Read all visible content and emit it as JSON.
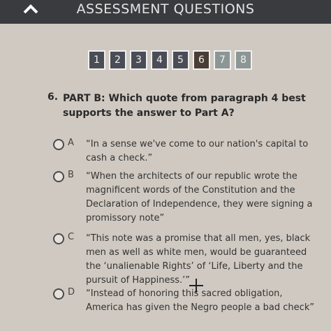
{
  "header": {
    "title": "ASSESSMENT QUESTIONS",
    "collapse_icon": "chevron-up-icon"
  },
  "nav": {
    "tabs": [
      {
        "label": "1",
        "state": "default"
      },
      {
        "label": "2",
        "state": "default"
      },
      {
        "label": "3",
        "state": "default"
      },
      {
        "label": "4",
        "state": "default"
      },
      {
        "label": "5",
        "state": "default"
      },
      {
        "label": "6",
        "state": "active"
      },
      {
        "label": "7",
        "state": "done"
      },
      {
        "label": "8",
        "state": "done"
      }
    ]
  },
  "question": {
    "number": "6.",
    "prompt": "PART B: Which quote from paragraph 4 best supports the answer to Part A?"
  },
  "options": [
    {
      "letter": "A",
      "text": "“In a sense we've come to our nation's capital to cash a check.”"
    },
    {
      "letter": "B",
      "text": "“When the architects of our republic wrote the magnificent words of the Constitution and the Declaration of Independence, they were signing a promissory note”"
    },
    {
      "letter": "C",
      "text": "“This note was a promise that all men, yes, black men as well as white men, would be guaranteed the ‘unalienable Rights’ of ‘Life, Liberty and the pursuit of Happiness.’”"
    },
    {
      "letter": "D",
      "text": "“Instead of honoring this sacred obligation, America has given the Negro people a bad check”"
    }
  ],
  "colors": {
    "header_bg": "#3a3b3f",
    "page_bg": "#cfc9c1",
    "tab_bg": "#4a4d55",
    "tab_active": "#4a3d35",
    "tab_done": "#8c9694"
  }
}
